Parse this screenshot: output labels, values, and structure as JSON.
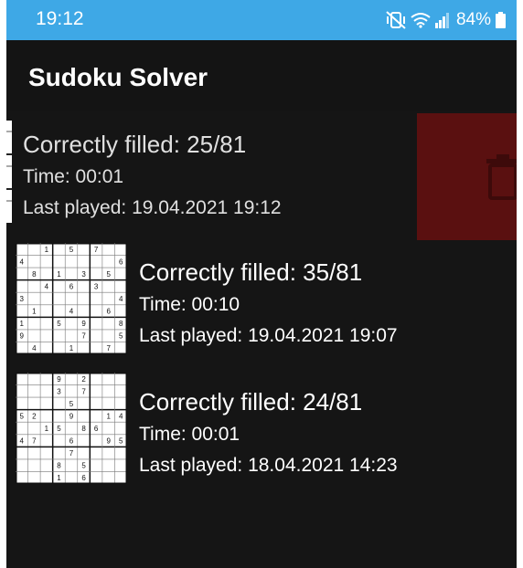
{
  "status_bar": {
    "time": "19:12",
    "battery": "84%",
    "icons": [
      "mute-vibrate-icon",
      "wifi-icon",
      "signal-icon",
      "battery-icon"
    ]
  },
  "app_bar": {
    "title": "Sudoku Solver"
  },
  "games": [
    {
      "score": "Correctly filled: 25/81",
      "time": "Time: 00:01",
      "last_played": "Last played: 19.04.2021 19:12",
      "swiped_to_delete": true
    },
    {
      "score": "Correctly filled: 35/81",
      "time": "Time: 00:10",
      "last_played": "Last played: 19.04.2021 19:07",
      "grid": [
        "  1 5 7  ",
        "4       6",
        " 8 1 3 5 ",
        "  4 6 3  ",
        "3       4",
        " 1  4  6 ",
        "1  5 9  8",
        "9    7  5",
        " 4  1  7 "
      ]
    },
    {
      "score": "Correctly filled: 24/81",
      "time": "Time: 00:01",
      "last_played": "Last played: 18.04.2021 14:23",
      "grid": [
        "   9 2   ",
        "   3 7   ",
        "    5    ",
        "52  9  14",
        "  15 86  ",
        "47  6  95",
        "    7    ",
        "   8 5   ",
        "   1 6   "
      ]
    }
  ],
  "colors": {
    "status_bar": "#3ea8e6",
    "background": "#151515",
    "delete_background": "#5a1010",
    "text": "#ffffff"
  }
}
